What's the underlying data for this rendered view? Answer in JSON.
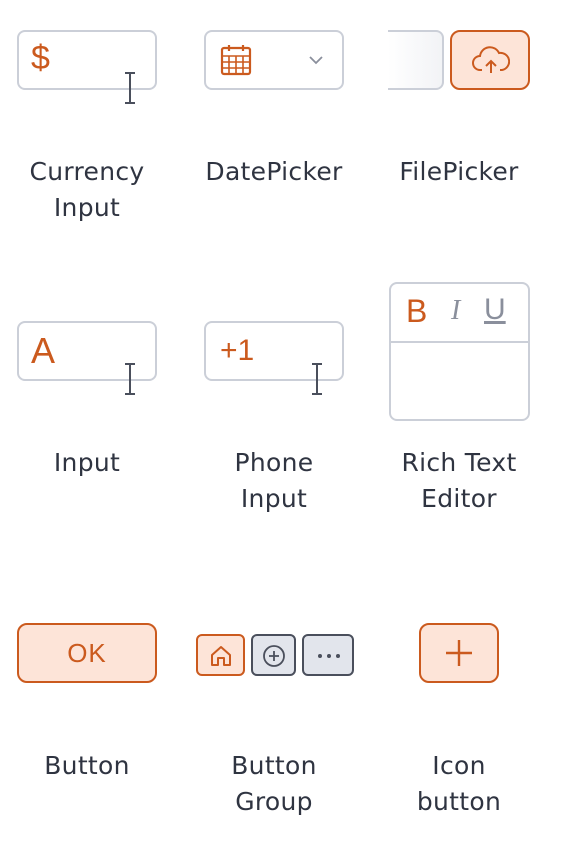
{
  "widgets": [
    {
      "id": "currency-input",
      "label": "Currency\nInput",
      "glyph": "$"
    },
    {
      "id": "datepicker",
      "label": "DatePicker"
    },
    {
      "id": "filepicker",
      "label": "FilePicker"
    },
    {
      "id": "input",
      "label": "Input",
      "glyph": "A"
    },
    {
      "id": "phone-input",
      "label": "Phone\nInput",
      "glyph": "+1"
    },
    {
      "id": "rich-text-editor",
      "label": "Rich Text\nEditor",
      "bold": "B",
      "italic": "I",
      "underline": "U"
    },
    {
      "id": "button",
      "label": "Button",
      "button_text": "OK"
    },
    {
      "id": "button-group",
      "label": "Button\nGroup"
    },
    {
      "id": "icon-button",
      "label": "Icon\nbutton"
    }
  ],
  "colors": {
    "accent": "#cb5a1e",
    "accent_fill": "#fde4d8",
    "border": "#cbcfd8",
    "label_text": "#2f3441",
    "group_gray_fill": "#e2e5ec"
  },
  "icons": [
    "dollar-icon",
    "calendar-icon",
    "chevron-down-icon",
    "cloud-upload-icon",
    "text-cursor-icon",
    "home-icon",
    "plus-circle-icon",
    "more-horizontal-icon",
    "plus-icon"
  ]
}
